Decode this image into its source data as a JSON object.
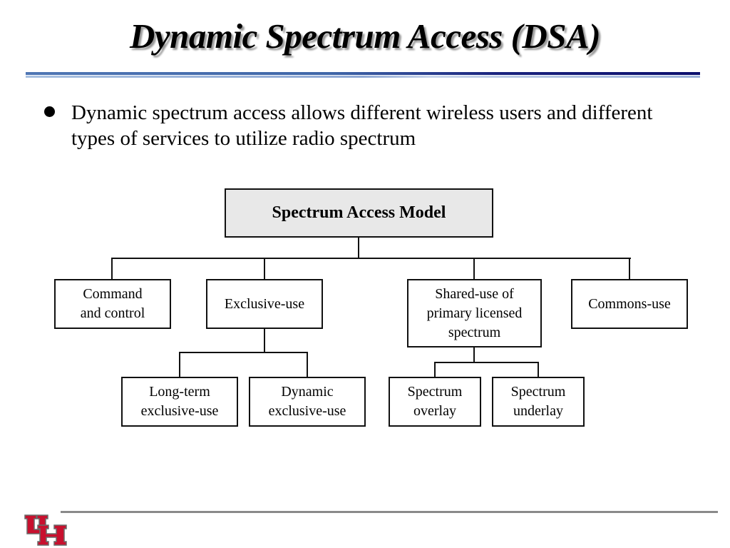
{
  "slide": {
    "title": "Dynamic Spectrum Access (DSA)",
    "bullets": [
      "Dynamic spectrum access allows different wireless users and different types of services to utilize radio spectrum"
    ]
  },
  "diagram": {
    "root": {
      "id": "root",
      "label": "Spectrum Access Model"
    },
    "level1": [
      {
        "id": "command",
        "label": "Command\nand control"
      },
      {
        "id": "exclusive",
        "label": "Exclusive-use"
      },
      {
        "id": "shared",
        "label": "Shared-use of\nprimary licensed\nspectrum"
      },
      {
        "id": "commons",
        "label": "Commons-use"
      }
    ],
    "level2": [
      {
        "id": "long-term",
        "parent": "exclusive",
        "label": "Long-term\nexclusive-use"
      },
      {
        "id": "dynamic",
        "parent": "exclusive",
        "label": "Dynamic\nexclusive-use"
      },
      {
        "id": "overlay",
        "parent": "shared",
        "label": "Spectrum\noverlay"
      },
      {
        "id": "underlay",
        "parent": "shared",
        "label": "Spectrum\nunderlay"
      }
    ],
    "colors": {
      "root_fill": "#e8e8e8",
      "node_fill": "#ffffff",
      "stroke": "#111111"
    }
  },
  "footer": {
    "logo": "university-of-houston-uh-logo",
    "logo_color": "#c8102e"
  }
}
